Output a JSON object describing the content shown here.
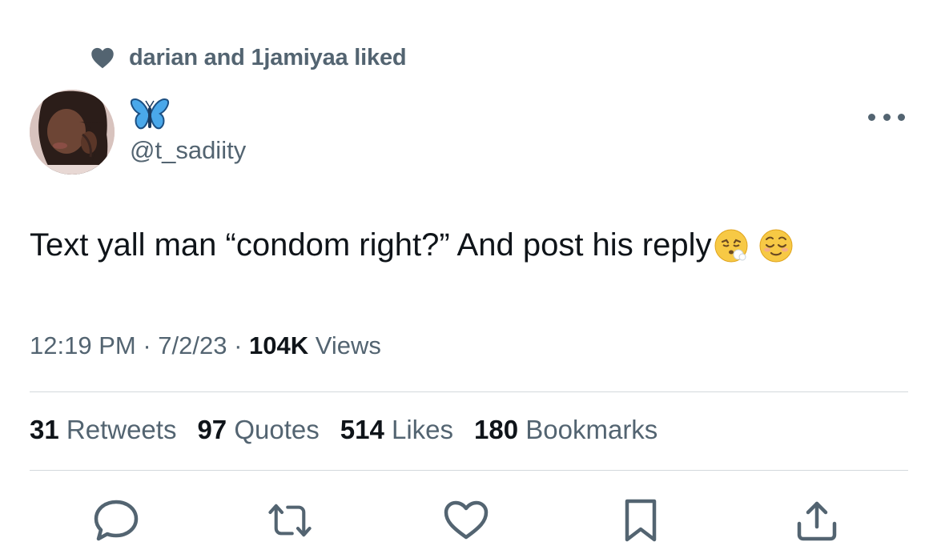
{
  "social_context": {
    "text": "darian and 1jamiyaa liked",
    "icon": "heart-icon"
  },
  "author": {
    "display_name_icon": "butterfly-emoji",
    "handle": "@t_sadiity"
  },
  "tweet": {
    "text": "Text yall man “condom right?” And post his reply",
    "emojis": [
      "face-exhaling-emoji",
      "relieved-face-emoji"
    ]
  },
  "meta": {
    "time": "12:19 PM",
    "sep1": " · ",
    "date": "7/2/23",
    "sep2": " · ",
    "views_count": "104K",
    "views_label": " Views"
  },
  "stats": {
    "retweets": {
      "count": "31",
      "label": " Retweets"
    },
    "quotes": {
      "count": "97",
      "label": " Quotes"
    },
    "likes": {
      "count": "514",
      "label": " Likes"
    },
    "bookmarks": {
      "count": "180",
      "label": " Bookmarks"
    }
  },
  "actions": [
    "reply-icon",
    "retweet-icon",
    "like-icon",
    "bookmark-icon",
    "share-icon"
  ],
  "colors": {
    "text_primary": "#0f1419",
    "text_secondary": "#536471",
    "divider": "#d3d8dc"
  }
}
